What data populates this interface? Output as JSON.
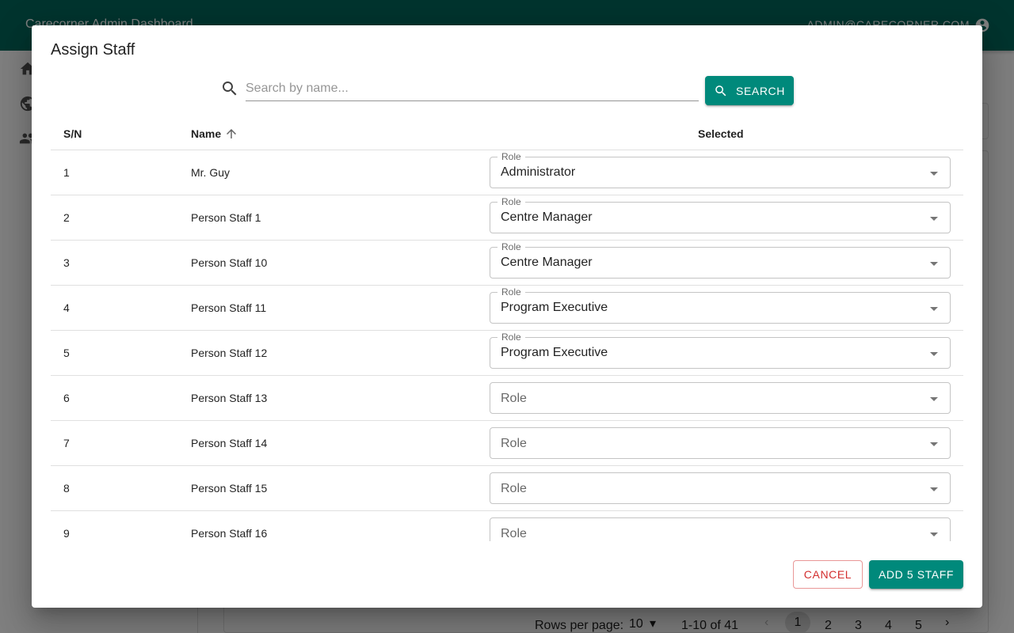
{
  "app": {
    "title": "Carecorner Admin Dashboard",
    "user_email": "ADMIN@CARECORNER.COM"
  },
  "background_pagination": {
    "rows_per_page_label": "Rows per page:",
    "rows_per_page": "10",
    "range": "1-10 of 41",
    "pages": [
      "1",
      "2",
      "3",
      "4",
      "5"
    ],
    "current_page": "1"
  },
  "dialog": {
    "title": "Assign Staff",
    "search": {
      "placeholder": "Search by name...",
      "value": "",
      "button_label": "SEARCH"
    },
    "table": {
      "headers": {
        "sn": "S/N",
        "name": "Name",
        "selected": "Selected"
      },
      "sort": {
        "column": "Name",
        "direction": "ascending"
      },
      "role_field_label": "Role",
      "rows": [
        {
          "sn": "1",
          "name": "Mr. Guy",
          "role": "Administrator"
        },
        {
          "sn": "2",
          "name": "Person Staff 1",
          "role": "Centre Manager"
        },
        {
          "sn": "3",
          "name": "Person Staff 10",
          "role": "Centre Manager"
        },
        {
          "sn": "4",
          "name": "Person Staff 11",
          "role": "Program Executive"
        },
        {
          "sn": "5",
          "name": "Person Staff 12",
          "role": "Program Executive"
        },
        {
          "sn": "6",
          "name": "Person Staff 13",
          "role": ""
        },
        {
          "sn": "7",
          "name": "Person Staff 14",
          "role": ""
        },
        {
          "sn": "8",
          "name": "Person Staff 15",
          "role": ""
        },
        {
          "sn": "9",
          "name": "Person Staff 16",
          "role": ""
        }
      ]
    },
    "actions": {
      "cancel_label": "CANCEL",
      "add_label": "ADD 5 STAFF"
    }
  },
  "colors": {
    "primary": "#00897b",
    "appbar": "#00695c",
    "danger": "#d32f2f"
  }
}
